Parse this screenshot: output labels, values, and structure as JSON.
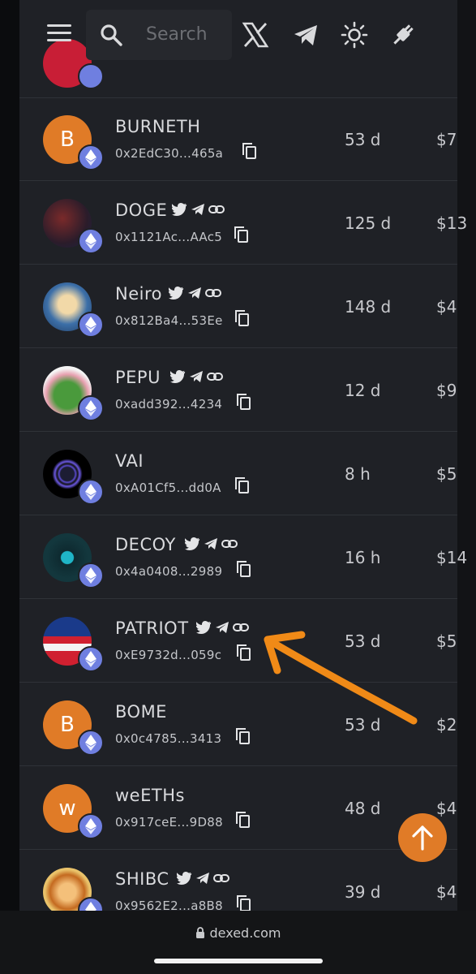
{
  "header": {
    "search_placeholder": "Search",
    "icons": [
      "menu-icon",
      "search-icon",
      "x-icon",
      "telegram-icon",
      "theme-icon",
      "plug-icon"
    ]
  },
  "rows": [
    {
      "name": "BURNETH",
      "address": "0x2EdC30...465a",
      "age": "53 d",
      "price": "$7",
      "avatar": "B",
      "socials": false
    },
    {
      "name": "DOGE",
      "address": "0x1121Ac...AAc5",
      "age": "125 d",
      "price": "$13",
      "avatar": "img",
      "socials": true
    },
    {
      "name": "Neiro",
      "address": "0x812Ba4...53Ee",
      "age": "148 d",
      "price": "$4",
      "avatar": "img",
      "socials": true
    },
    {
      "name": "PEPU",
      "address": "0xadd392...4234",
      "age": "12 d",
      "price": "$9",
      "avatar": "img",
      "socials": true
    },
    {
      "name": "VAI",
      "address": "0xA01Cf5...dd0A",
      "age": "8 h",
      "price": "$5",
      "avatar": "img",
      "socials": false
    },
    {
      "name": "DECOY",
      "address": "0x4a0408...2989",
      "age": "16 h",
      "price": "$14",
      "avatar": "img",
      "socials": true
    },
    {
      "name": "PATRIOT",
      "address": "0xE9732d...059c",
      "age": "53 d",
      "price": "$5",
      "avatar": "img",
      "socials": true
    },
    {
      "name": "BOME",
      "address": "0x0c4785...3413",
      "age": "53 d",
      "price": "$2",
      "avatar": "B",
      "socials": false
    },
    {
      "name": "weETHs",
      "address": "0x917ceE...9D88",
      "age": "48 d",
      "price": "$4",
      "avatar": "w",
      "socials": false
    },
    {
      "name": "SHIBC",
      "address": "0x9562E2...a8B8",
      "age": "39 d",
      "price": "$4",
      "avatar": "img",
      "socials": true
    }
  ],
  "footer": {
    "url": "dexed.com"
  },
  "colors": {
    "accent": "#e07b27",
    "eth": "#6f7fe0",
    "panel": "#1f2126"
  }
}
